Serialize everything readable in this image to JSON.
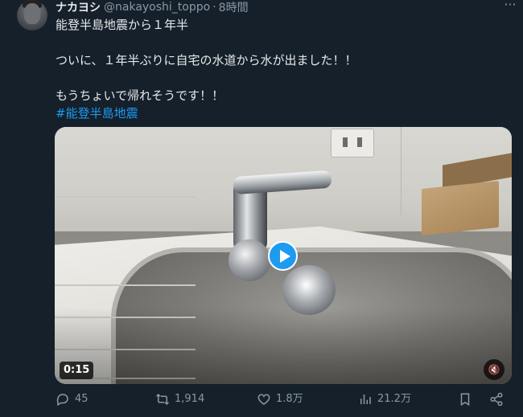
{
  "post": {
    "display_name": "ナカヨシ",
    "handle": "@nakayoshi_toppo",
    "separator": "·",
    "time": "8時間",
    "more_label": "···",
    "lines": [
      "能登半島地震から１年半",
      "ついに、１年半ぶりに自宅の水道から水が出ました！！",
      "もうちょいで帰れそうです！！"
    ],
    "hashtag": "#能登半島地震"
  },
  "media": {
    "duration": "0:15",
    "play_icon": "play-icon",
    "mute_icon": "mute-icon"
  },
  "actions": {
    "replies": "45",
    "reposts": "1,914",
    "likes": "1.8万",
    "views": "21.2万"
  },
  "colors": {
    "background": "#15202b",
    "text": "#e7e9ea",
    "muted": "#8b98a5",
    "accent": "#1d9bf0"
  }
}
